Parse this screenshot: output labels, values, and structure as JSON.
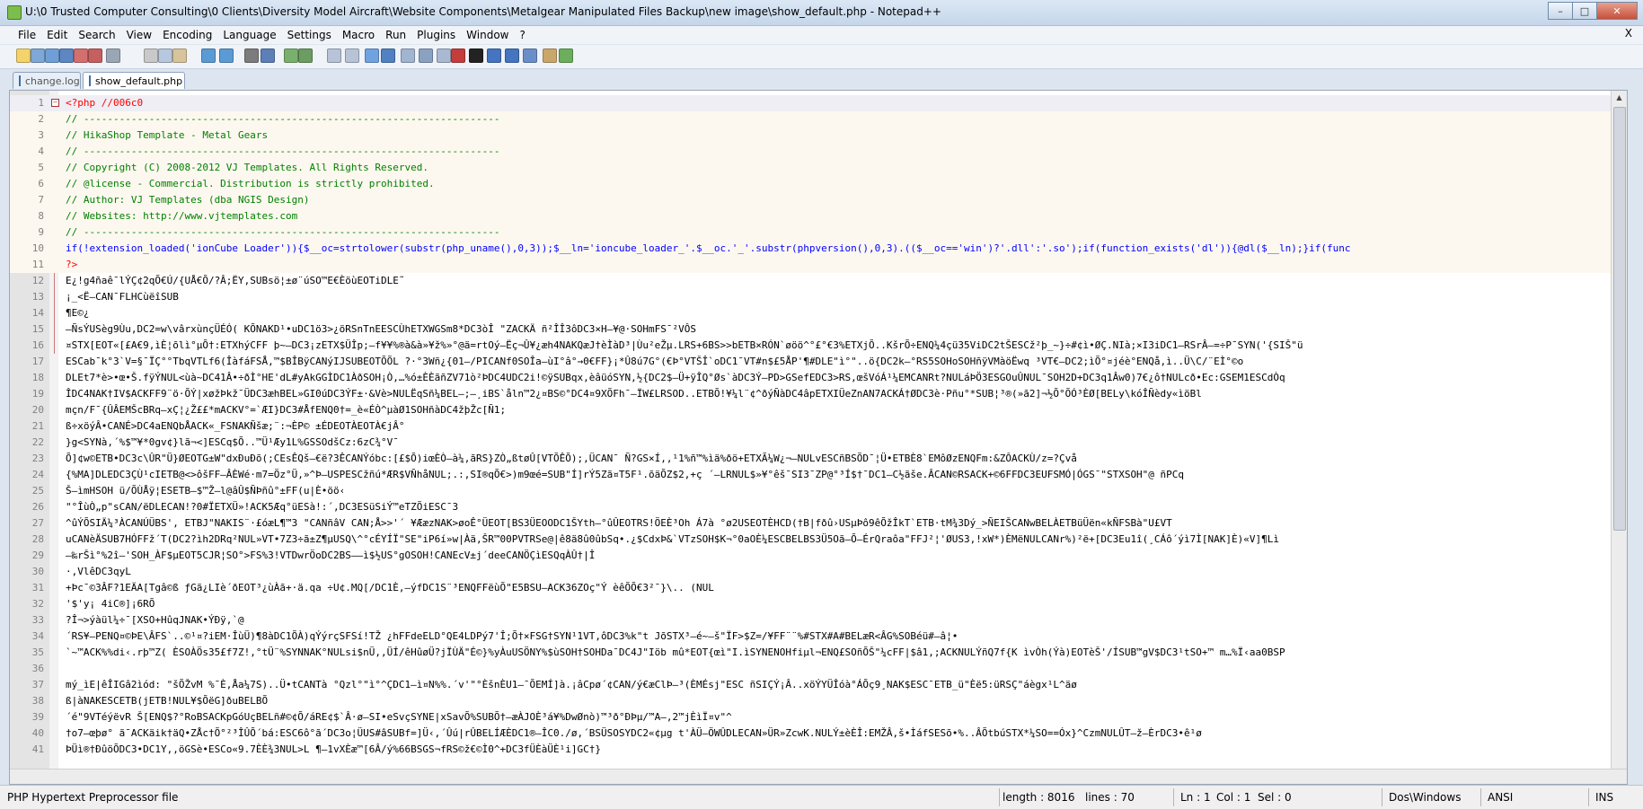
{
  "window": {
    "title": "U:\\0 Trusted Computer Consulting\\0 Clients\\Diversity Model Aircraft\\Website Components\\Metalgear Manipulated Files Backup\\new image\\show_default.php - Notepad++",
    "buttons": {
      "minimize": "–",
      "maximize": "□",
      "close": "✕"
    }
  },
  "menu": {
    "items": [
      "File",
      "Edit",
      "Search",
      "View",
      "Encoding",
      "Language",
      "Settings",
      "Macro",
      "Run",
      "Plugins",
      "Window",
      "?"
    ],
    "close_doc": "X"
  },
  "toolbar": {
    "icons": [
      "new-file-icon",
      "open-file-icon",
      "save-icon",
      "save-all-icon",
      "close-icon",
      "close-all-icon",
      "print-icon",
      "cut-icon",
      "copy-icon",
      "paste-icon",
      "undo-icon",
      "redo-icon",
      "find-icon",
      "replace-icon",
      "zoom-in-icon",
      "zoom-out-icon",
      "sync-v-icon",
      "sync-h-icon",
      "word-wrap-icon",
      "show-all-chars-icon",
      "indent-guide-icon",
      "doc-map-icon",
      "function-list-icon",
      "record-macro-icon",
      "stop-record-icon",
      "play-macro-icon",
      "play-multiple-icon",
      "save-macro-icon",
      "launch-browser-icon",
      "spellcheck-icon"
    ]
  },
  "tabs": [
    {
      "label": "change.log",
      "active": false
    },
    {
      "label": "show_default.php",
      "active": true
    }
  ],
  "editor": {
    "lines": [
      {
        "n": "1",
        "text": "<?php //006c0"
      },
      {
        "n": "2",
        "text": "// ----------------------------------------------------------------------"
      },
      {
        "n": "3",
        "text": "//  HikaShop Template - Metal Gears"
      },
      {
        "n": "4",
        "text": "// ----------------------------------------------------------------------"
      },
      {
        "n": "5",
        "text": "//  Copyright (C) 2008-2012 VJ Templates. All Rights Reserved."
      },
      {
        "n": "6",
        "text": "//  @license - Commercial. Distribution is strictly prohibited."
      },
      {
        "n": "7",
        "text": "//  Author: VJ Templates (dba NGIS Design)"
      },
      {
        "n": "8",
        "text": "//  Websites: http://www.vjtemplates.com"
      },
      {
        "n": "9",
        "text": "// ----------------------------------------------------------------------"
      },
      {
        "n": "10",
        "text": "if(!extension_loaded('ionCube Loader')){$__oc=strtolower(substr(php_uname(),0,3));$__ln='ioncube_loader_'.$__oc.'_'.substr(phpversion(),0,3).(($__oc=='win')?'.dll':'.so');if(function_exists('dl')){@dl($__ln);}if(func"
      },
      {
        "n": "11",
        "text": "?>"
      },
      {
        "n": "12",
        "text": "E¿!g4ñaê¯lÝÇ¢2qÕ€Ú/{UÅ€Õ/?Â;ËY,SUBsö¦±ø¨úSO™E€ÈöùEOTiDLE˜"
      },
      {
        "n": "13",
        "text": "¡_<Ë–CAN¯FLHCùëîSUB"
      },
      {
        "n": "14",
        "text": "¶E©¿"
      },
      {
        "n": "15",
        "text": "–ÑsÝUSèg9Ùu,DC2=w\\vârxùnçÜÉÓ(   KÕNAKD¹•uDC1ö3>¿öRSnTnEESCÙhETXWGSm8*DC3òÎ  \"ZACKÄ ñ²ÎÎ3ôDC3×H–¥@·SOHmFS¯²VÔS"
      },
      {
        "n": "16",
        "text": "¤STX[EOT«[£A€9,ìÈ¦õlì°µÕ†:ETXhýCFF þ~–DC3¡zETX$ÜÎp;–f¥¥%®à&à»¥ž%»°@ä=rtOý–Ëç¬Û¥¿æh4NAKQæJ†èÌàD³|Ùu²eŽµ.LRS+6BS>>bETB×RÓN`øöö^°£°€3%ETXjÕ..KšrÕ÷ENQ¼4çü35ViDC2tŠESCž²þ_~}÷#¢ì•ØÇ.NIà;×I3iDC1–RSrÂ–=÷P¯SYN('{SIŠ\"ü"
      },
      {
        "n": "17",
        "text": "ESCab¯k°3`V=§¯ÏÇ°°TbqVTLf6(ÎàfáFSÅ,™$BÎBÿCANýIJSUBEOTÕÕL ?·°3Wñ¿{01–/PICANf0SOÎa–ùI°â°→0€FF}¡*Û8ú7G°(€Þ°VTŠÎ`oDC1¯VT#n$£5ÅP'¶#DLE\"ì°\"..ö{DC2k–°RS5SOHoSOHñÿVMàöËwq ³VT€–DC2;ìÕ°¤jéè°ENQå,ì..Ü\\C/¨EÌ°©o"
      },
      {
        "n": "18",
        "text": "DLEt7*è>•œ•Š.fÿÝNUL<ùà~DC41Â•÷ðÌ°HE'dL#yAkGGÌDC1ÀðSOH¡Ò,…%ó±ÈÈãñZV71ò²ÞDC4UDC2i!©ÿSUBqx,èâüóSYN,½{DC2$–Ü+ÿÎQ°Øs`àDC3Ý–PD>GSefEDC3>RS,œšVóÁ¹¼EMCANRt?NULáÞÖ3ESGOuÛNUL¯SOH2D+DC3q1Âw0)7€¿ô†NULcð•Ec:GSEM1ESCdÒq"
      },
      {
        "n": "19",
        "text": "ÎDC4NAK†IV$ACKFF9¨ö·ÕÝ|xøžÞkž¯ÜDC3æhBEL»GI0úDC3ÝF±·&Vè>NULËqSñ¼BEL–;–¸iBS`åln™2¿¤BS©°DC4¤9XÕFh¯–ÏW£LRSOD..ETBÕ!¥¼l¨¢^ðýÑàDC4âpETXIÜeZnAN7ACKÁ†ØDC3è·Pñu°*SUB¦³®(»ã2]¬½Õ°ÕÓ³ÈØ[BELy\\kóÎÑèdy«ìöBl"
      },
      {
        "n": "20",
        "text": "mçn/F¯{ÛÂEMŠcBRq–xÇ¦¿Ž££*mACKV°=`ÆI}DC3#ÅfENQ0†=_è«ÉÒ^µàØ1SOHñàDC4žþŽc[Ñ1;"
      },
      {
        "n": "21",
        "text": "ß÷xöýÂ•CANÉ>DC4aENQbÅACK«_FSNAKÑšæ;¨:¬ÈP©  ±ÉDEOTÀEOTÀ€jÂ°"
      },
      {
        "n": "22",
        "text": "}g<SYNà,´%$™¥*0gv¢}lã¬<]ESCq$Õ..™Ü¹Æy1L%GSSOdšCz:6zC¾°V¯"
      },
      {
        "n": "23",
        "text": "Õ]¢w©ETB•DC3c\\ÛR\"Ü}ØEOTG±W\"dxÐuÐõ(;CEsÊQš–€ë?3ÊCANÝóbc:[£$Õ)iœÈÒ–à¼,ãRS}ZÒ„ßtøÛ[VTÕÊÕ);,ÜCAN¯ Ñ?GS×Í,,¹1%ñ™%ìä%ðö+ETXÃ¼W¿¬–NULvESCñBSÕD¯¦Ü•ETBÈ8`EMôØzENQFm:&ZÔACKÙ/z=?Çvå"
      },
      {
        "n": "24",
        "text": "{%MA]DLEDC3ÇÙ¹cIETB@<>ôšFF–ÂÈWé·m7=Öz°Ü,»^Þ–USPESCžñú*ÆR$VÑhåNUL;.:,SI®qÕ€>)m9œé=SUB\"Í]rÝ5Zã¤T5F¹.õäÕZ$2,+ç ´–LRNUL$»¥°êš¯SI3¯ZP@°³Í$†¯DC1–C½ãše.ÂCAN©RSACK+©6FFDC3EUFSMÓ|ÓGS¯\"STXSOH\"@ ñPCq"
      },
      {
        "n": "25",
        "text": "Š–ìmHSOH ü/ÕÙÅÿ¦ESETB–$™Ž–l@âÛ$ÑÞñû°±FF(u|È•öö‹"
      },
      {
        "n": "26",
        "text": "\"°ÎùÒ„p\"sCAN/ëDLECAN!?0#ÏETXÜ»!ACK5Æq°üESà!:´,DC3ESüSiÝ™eTZÕiESC¯3"
      },
      {
        "n": "27",
        "text": "^ûÝÕSIÄ¼³ÀCANÚÜBS',  ETBJ\"NAKIS¨·£óæL¶™3 \"CANñâV CAN;Å>>'´ ¥ÆæzNAK>øoÊ°ÜEOT[BS3ÜEOODC1ŠYth–°ûÛEOTRS!ÖEÈ³Oh Á7à  °ø2USEOTÈHCD(†B|fðû›USµÞô9êÕžÎkT`ETB·tM¾3Dý_>ÑEIŠCANwBELÀETBüÜën«kÑFSBà\"U£VT"
      },
      {
        "n": "28",
        "text": "uCANèÄSUB7HÓFFž´T(DC2?ìh2DRq²NUL»VT•7Z3÷ã±Z¶µUSQ\\^°cÉYÍÏ\"SE\"iP6í»w|Àä,ŠR™00PVTRSe@|ê8ä8û0ûbSq•.¿$CdxÞ&`VTzSOH$K¬°0aOÈ¼ESCBELBS3Ü5Oã–Õ–ÉrQraôa\"FFJ²¦'ØUS3,!xW*)ÈMëNULCANr%)²ë+[DC3Eu1î(¸CÁô´ýì7Ì[NAK]È)«V]¶Lì"
      },
      {
        "n": "29",
        "text": "–‰rŠì°%2î–'SOH_ÀF$µEOT5CJR¦SO°>FS%3!VTDwrÖoDC2BS––ì$½US°gOSOH!CANEcV±j´deeCANÖÇìESQqÀÛ†|Î"
      },
      {
        "n": "30",
        "text": "·,VlêDC3qyL"
      },
      {
        "n": "31",
        "text": "+Þc¯©3ÂF?1EÄA[Tgâ©ß ƒGã¿LIè´ðEOT³¿ùÀã+·ä.qa ÷U¢.MQ[/DC1È,–ýfDC1S¨³ENQFFëùÕ\"E5BSU–ACK36ZOç\"Ý èêÕÕ€3²¯}\\..  (NUL"
      },
      {
        "n": "32",
        "text": "'$'y¡ 4iC®]¡6RÕ"
      },
      {
        "n": "33",
        "text": "?Î¬>ýàül¼÷¯[XSO+HûqJNAK•ÝÐÿ,`@"
      },
      {
        "n": "34",
        "text": "´RS¥–PENQ¤©ÞE\\ÂFS`..©¹¤?iEM·ÎùÜ)¶8àDC1ÕÀ)qÝýrçSFSí!TŽ  ¿hFFdeELD°QE4LDPý7'Î;Õ†×FSG†SYN¹1VT,ôDC3%k\"t JõSTX³–é~–š\"ÏF>$Z=/¥FF¨¨%#STX#A#BELæR<ÂG%SOBéü#–â¦•"
      },
      {
        "n": "35",
        "text": "`~™ACK%%di‹.rþ™Z( ÈSOÀÖs35£f7Z!,°tÜ¨%SYNNAK°NULsi$nÜ,,ÜÍ/êHûøÜ?jÏÙÄ\"É©}%yÀuUSÖNY%$ùSOH†SOHDa¯DC4J\"Iöb     mû*EOT{œì\"I.ìSYNENOHfiµl¬ENQ£SOñÕŠ\"¼cFF|$â1,;ACKNULÝñQ7f{K ìvÒh(Ýà)EOTèŠ'/ÍSUB™gV$DC3¹tSO+™ m…%Ï‹aa0BSP"
      },
      {
        "n": "36",
        "text": ""
      },
      {
        "n": "37",
        "text": "mý_ìE|êÎIGâ2ìód:  \"šÕŽvM     %¯È,Åa¼7S)..Ü•tCANTà °Qzl°\"ì°^ÇDC1–ì¤N%%.´v'\"°ÈšnÈU1–¯ÕEMÍ]à.¡âCpø´¢CAN/ý€æClÞ–³(ÈMÉsj\"ESC ñSIÇÝ¡Â..xöÝYÜÎóà°ÁÕç9¸NAK$ESC¯ETB_ü\"Èë5:üRSÇ\"áègx¹L^äø"
      },
      {
        "n": "38",
        "text": "ß|àNAKESCETB(jETB!NUL¥$ÕëG]ðuBELBÕ"
      },
      {
        "n": "39",
        "text": "´é\"9VTéýëvR Š[ENQ$?°RoBSACKpGóUçBELñ#©¢Õ/áRE¢$`Â·ø–SI•eSvçSYNE|xSavÕ%SUBÕ†–æÀJOÈ³á¥%DwØnò)™³ð°ÐÞµ/™A–,2™jÈìÏ¤v\"^"
      },
      {
        "n": "40",
        "text": "†o7–œþø°    ã¯ACKäik†äQ•ZÅc†Õ°²³ÎÛÕ´bá:ESC6ô°ã´DC3o¦ÜUS#âSUBf=]Ü‹,´Ûú|rÛBELÍÆÈDC1®–ÎC0./ø,´BSÜSOSYDC2«¢µg t'ÀÜ–ÖWÛDLECAN»ÜR»ZcwK.NULÝ±èÈÎ:EMŽÂ,š•ÌáfSESõ•%..ÂÕtbúSTX*¼SO==Óx}^CzmNULÛT–ž–ÈrDC3•ê¹ø"
      },
      {
        "n": "41",
        "text": "ÞÜì®†ÐûöÕDC3•DC1Y,,öGSè•ESCo«9.7ÈÈ¾3NUL>L ¶–1vXÈæ™[6Â/ý%66BSGS¬fRS©ž€©Ì0^+DC3fÜÈàÜÈ¹i]GC†}"
      }
    ]
  },
  "status": {
    "filetype": "PHP Hypertext Preprocessor file",
    "length": "length : 8016",
    "lines": "lines : 70",
    "ln": "Ln : 1",
    "col": "Col : 1",
    "sel": "Sel : 0",
    "eol": "Dos\\Windows",
    "encoding": "ANSI",
    "mode": "INS"
  }
}
